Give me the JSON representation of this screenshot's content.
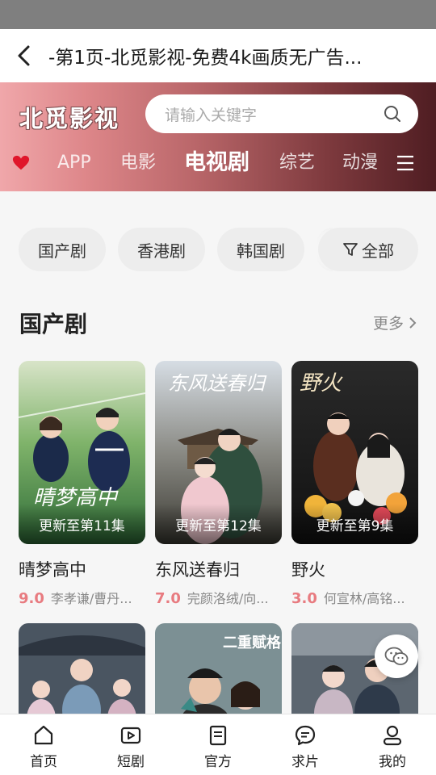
{
  "title_bar": {
    "title": "-第1页-北觅影视-免费4k画质无广告..."
  },
  "header": {
    "logo": "北觅影视",
    "search_placeholder": "请输入关键字",
    "nav": [
      {
        "label": "APP"
      },
      {
        "label": "电影"
      },
      {
        "label": "电视剧",
        "active": true
      },
      {
        "label": "综艺"
      },
      {
        "label": "动漫"
      }
    ]
  },
  "filters": [
    {
      "label": "国产剧"
    },
    {
      "label": "香港剧"
    },
    {
      "label": "韩国剧"
    },
    {
      "label": "全部"
    }
  ],
  "section": {
    "title": "国产剧",
    "more": "更多"
  },
  "cards": [
    {
      "title": "晴梦高中",
      "episode": "更新至第11集",
      "score": "9.0",
      "cast": "李孝谦/曹丹...",
      "poster_text": "晴梦高中"
    },
    {
      "title": "东风送春归",
      "episode": "更新至第12集",
      "score": "7.0",
      "cast": "完颜洛绒/向...",
      "poster_text": "东风送春归"
    },
    {
      "title": "野火",
      "episode": "更新至第9集",
      "score": "3.0",
      "cast": "何宣林/高铭...",
      "poster_text": "野火"
    }
  ],
  "row2_posters": [
    {
      "poster_text": ""
    },
    {
      "poster_text": "二重赋格"
    },
    {
      "poster_text": ""
    }
  ],
  "tabbar": [
    {
      "label": "首页",
      "icon": "home-icon"
    },
    {
      "label": "短剧",
      "icon": "play-icon"
    },
    {
      "label": "官方",
      "icon": "document-icon"
    },
    {
      "label": "求片",
      "icon": "chat-icon"
    },
    {
      "label": "我的",
      "icon": "user-icon"
    }
  ],
  "colors": {
    "accent": "#e87b80",
    "header_start": "#f0a7aa",
    "header_end": "#4f1d22"
  }
}
